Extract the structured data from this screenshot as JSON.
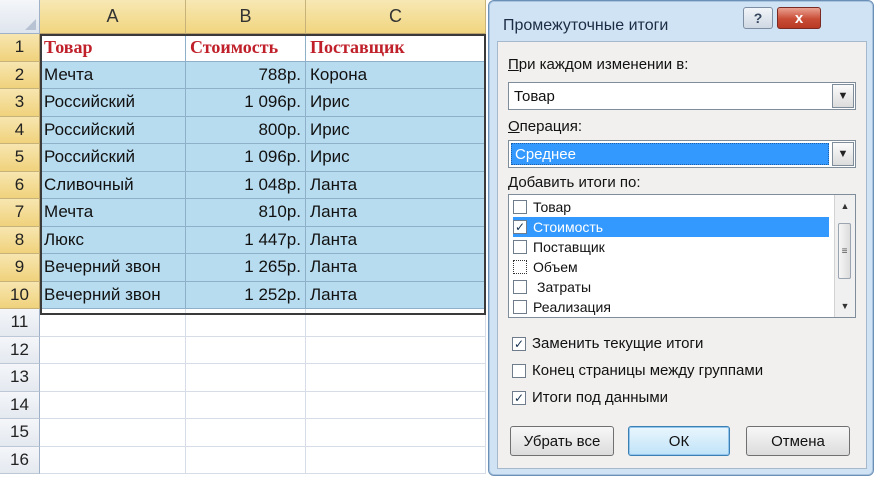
{
  "sheet": {
    "columns": [
      "A",
      "B",
      "C"
    ],
    "row_numbers": [
      "1",
      "2",
      "3",
      "4",
      "5",
      "6",
      "7",
      "8",
      "9",
      "10",
      "11",
      "12",
      "13",
      "14",
      "15",
      "16"
    ],
    "headers": {
      "a": "Товар",
      "b": "Стоимость",
      "c": "Поставщик"
    },
    "rows": [
      {
        "a": "Мечта",
        "b": "788р.",
        "c": "Корона"
      },
      {
        "a": "Российский",
        "b": "1 096р.",
        "c": "Ирис"
      },
      {
        "a": "Российский",
        "b": "800р.",
        "c": "Ирис"
      },
      {
        "a": "Российский",
        "b": "1 096р.",
        "c": "Ирис"
      },
      {
        "a": "Сливочный",
        "b": "1 048р.",
        "c": "Ланта"
      },
      {
        "a": "Мечта",
        "b": "810р.",
        "c": "Ланта"
      },
      {
        "a": "Люкс",
        "b": "1 447р.",
        "c": "Ланта"
      },
      {
        "a": "Вечерний звон",
        "b": "1 265р.",
        "c": "Ланта"
      },
      {
        "a": "Вечерний звон",
        "b": "1 252р.",
        "c": "Ланта"
      }
    ],
    "colors": {
      "selection_fill": "#b8dcef",
      "header_text": "#c0202a",
      "column_header": "#f1d57f"
    }
  },
  "dialog": {
    "title": "Промежуточные итоги",
    "help_label": "?",
    "close_label": "x",
    "group_by_label": "При каждом изменении в:",
    "group_by_value": "Товар",
    "function_label": "Операция:",
    "function_value": "Среднее",
    "add_to_label": "Добавить итоги по:",
    "fields": [
      {
        "label": "Товар",
        "checked": false
      },
      {
        "label": "Стоимость",
        "checked": true
      },
      {
        "label": "Поставщик",
        "checked": false
      },
      {
        "label": "Объем",
        "checked": false
      },
      {
        "label": "Затраты",
        "checked": false
      },
      {
        "label": "Реализация",
        "checked": false
      }
    ],
    "replace_current_label": "Заменить текущие итоги",
    "page_break_label": "Конец страницы между группами",
    "summary_below_label": "Итоги под данными",
    "remove_all_label": "Убрать все",
    "ok_label": "ОК",
    "cancel_label": "Отмена",
    "check_mark": "✓",
    "colors": {
      "highlight": "#3399ff",
      "frame": "#cfe3f4",
      "close": "#c94c36"
    }
  }
}
